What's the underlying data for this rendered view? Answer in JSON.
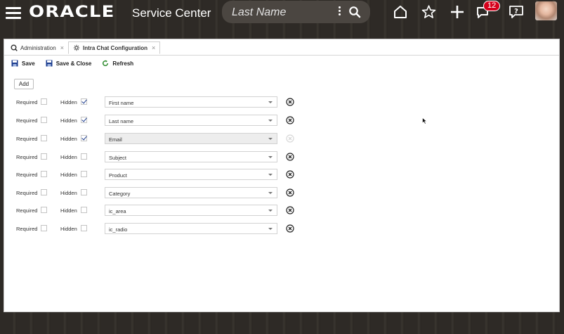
{
  "header": {
    "logo": "ORACLE",
    "product": "Service Center",
    "search_placeholder": "Last Name",
    "notifications_count": "12",
    "icons": [
      "menu-icon",
      "home-icon",
      "star-icon",
      "plus-icon",
      "chat-icon",
      "help-icon"
    ]
  },
  "tabs": [
    {
      "label": "Administration",
      "icon": "admin-icon",
      "active": false
    },
    {
      "label": "Intra Chat Configuration",
      "icon": "config-icon",
      "active": true
    }
  ],
  "toolbar": {
    "save": "Save",
    "save_close": "Save & Close",
    "refresh": "Refresh"
  },
  "add_label": "Add",
  "labels": {
    "required": "Required",
    "hidden": "Hidden"
  },
  "rows": [
    {
      "field": "First name",
      "required": false,
      "hidden": true,
      "disabled": false
    },
    {
      "field": "Last name",
      "required": false,
      "hidden": true,
      "disabled": false
    },
    {
      "field": "Email",
      "required": false,
      "hidden": true,
      "disabled": true
    },
    {
      "field": "Subject",
      "required": false,
      "hidden": false,
      "disabled": false
    },
    {
      "field": "Product",
      "required": false,
      "hidden": false,
      "disabled": false
    },
    {
      "field": "Category",
      "required": false,
      "hidden": false,
      "disabled": false
    },
    {
      "field": "ic_area",
      "required": false,
      "hidden": false,
      "disabled": false
    },
    {
      "field": "ic_radio",
      "required": false,
      "hidden": false,
      "disabled": false
    }
  ],
  "colors": {
    "accent": "#1a3b8e",
    "badge": "#d6001c",
    "refresh": "#2e8b2e"
  }
}
